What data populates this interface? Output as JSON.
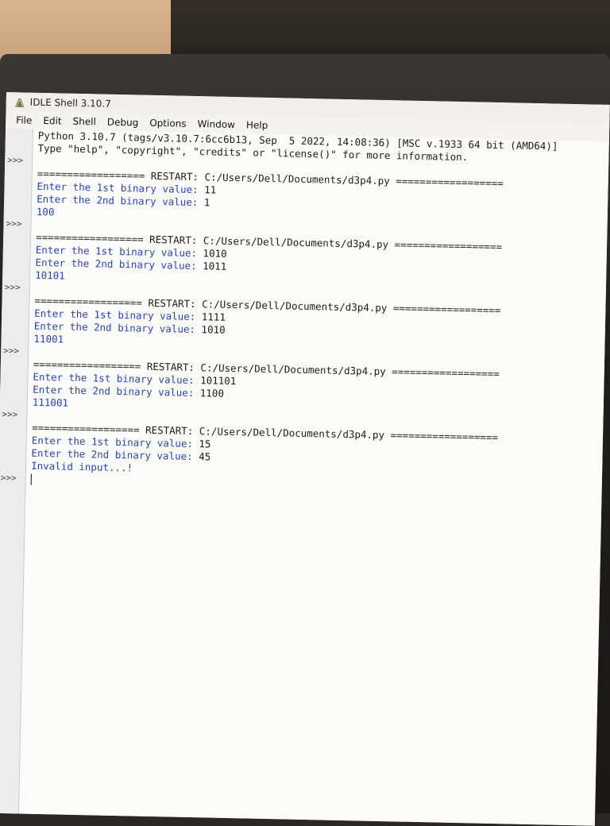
{
  "window": {
    "title": "IDLE Shell 3.10.7"
  },
  "menu": [
    "File",
    "Edit",
    "Shell",
    "Debug",
    "Options",
    "Window",
    "Help"
  ],
  "prompt_symbol": ">>>",
  "banner": [
    "Python 3.10.7 (tags/v3.10.7:6cc6b13, Sep  5 2022, 14:08:36) [MSC v.1933 64 bit (AMD64)]",
    "Type \"help\", \"copyright\", \"credits\" or \"license()\" for more information."
  ],
  "runs": [
    {
      "restart": "================== RESTART: C:/Users/Dell/Documents/d3p4.py ==================",
      "input1_prompt": "Enter the 1st binary value: ",
      "input1_value": "11",
      "input2_prompt": "Enter the 2nd binary value: ",
      "input2_value": "1",
      "output": "100"
    },
    {
      "restart": "================== RESTART: C:/Users/Dell/Documents/d3p4.py ==================",
      "input1_prompt": "Enter the 1st binary value: ",
      "input1_value": "1010",
      "input2_prompt": "Enter the 2nd binary value: ",
      "input2_value": "1011",
      "output": "10101"
    },
    {
      "restart": "================== RESTART: C:/Users/Dell/Documents/d3p4.py ==================",
      "input1_prompt": "Enter the 1st binary value: ",
      "input1_value": "1111",
      "input2_prompt": "Enter the 2nd binary value: ",
      "input2_value": "1010",
      "output": "11001"
    },
    {
      "restart": "================== RESTART: C:/Users/Dell/Documents/d3p4.py ==================",
      "input1_prompt": "Enter the 1st binary value: ",
      "input1_value": "101101",
      "input2_prompt": "Enter the 2nd binary value: ",
      "input2_value": "1100",
      "output": "111001"
    },
    {
      "restart": "================== RESTART: C:/Users/Dell/Documents/d3p4.py ==================",
      "input1_prompt": "Enter the 1st binary value: ",
      "input1_value": "15",
      "input2_prompt": "Enter the 2nd binary value: ",
      "input2_value": "45",
      "output": "Invalid input...!"
    }
  ],
  "colors": {
    "stdout_blue": "#2a44b8",
    "text": "#1c1c1c",
    "editor_bg": "#fbfbfa"
  }
}
